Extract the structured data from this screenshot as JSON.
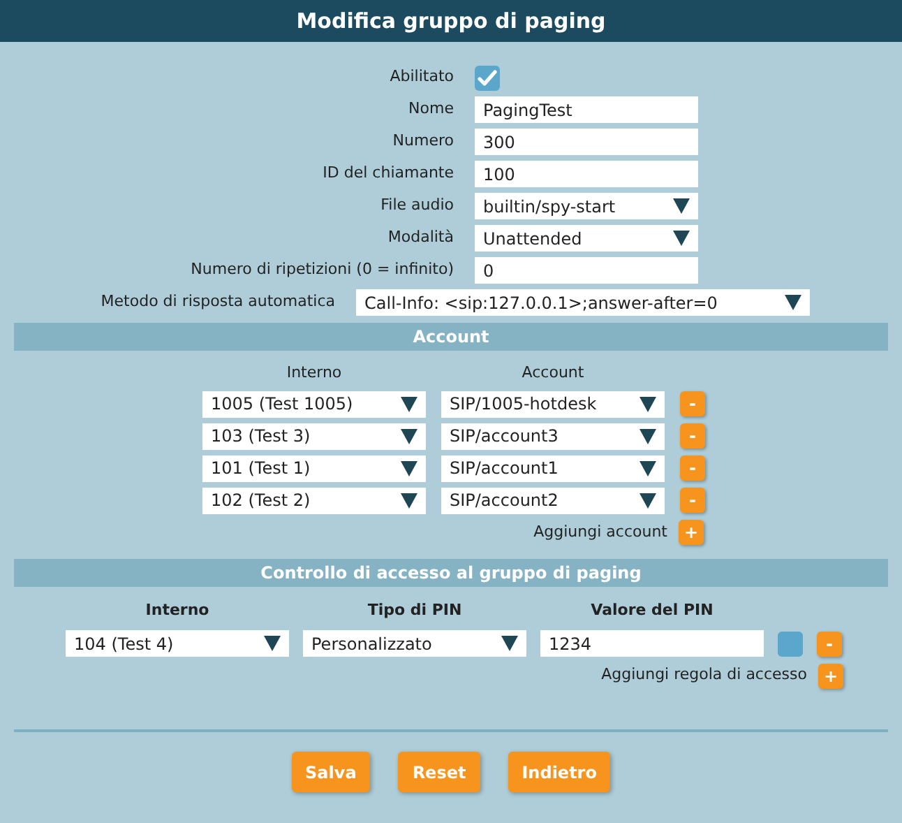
{
  "window": {
    "title": "Modifica gruppo di paging"
  },
  "fields": [
    {
      "kind": "checkbox",
      "label": "Abilitato",
      "checked": true
    },
    {
      "kind": "text",
      "label": "Nome",
      "value": "PagingTest"
    },
    {
      "kind": "text",
      "label": "Numero",
      "value": "300"
    },
    {
      "kind": "text",
      "label": "ID del chiamante",
      "value": "100"
    },
    {
      "kind": "select",
      "label": "File audio",
      "value": "builtin/spy-start"
    },
    {
      "kind": "select",
      "label": "Modalità",
      "value": "Unattended"
    },
    {
      "kind": "text",
      "label": "Numero di ripetizioni (0 = infinito)",
      "value": "0"
    }
  ],
  "auto_answer": {
    "label": "Metodo di risposta automatica",
    "value": "Call-Info: <sip:127.0.0.1>;answer-after=0"
  },
  "account_section": {
    "title": "Account",
    "columns": [
      "Interno",
      "Account"
    ],
    "rows": [
      {
        "interno": "1005 (Test 1005)",
        "account": "SIP/1005-hotdesk",
        "remove": "-"
      },
      {
        "interno": "103 (Test 3)",
        "account": "SIP/account3",
        "remove": "-"
      },
      {
        "interno": "101 (Test 1)",
        "account": "SIP/account1",
        "remove": "-"
      },
      {
        "interno": "102 (Test 2)",
        "account": "SIP/account2",
        "remove": "-"
      }
    ],
    "add_label": "Aggiungi account",
    "add_button": "+"
  },
  "access_section": {
    "title": "Controllo di accesso al gruppo di paging",
    "columns": [
      "Interno",
      "Tipo di PIN",
      "Valore del PIN"
    ],
    "rows": [
      {
        "interno": "104 (Test 4)",
        "pin_type": "Personalizzato",
        "pin_value": "1234",
        "show_pin": false,
        "remove": "-"
      }
    ],
    "add_label": "Aggiungi regola di accesso",
    "add_button": "+"
  },
  "buttons": [
    "Salva",
    "Reset",
    "Indietro"
  ]
}
